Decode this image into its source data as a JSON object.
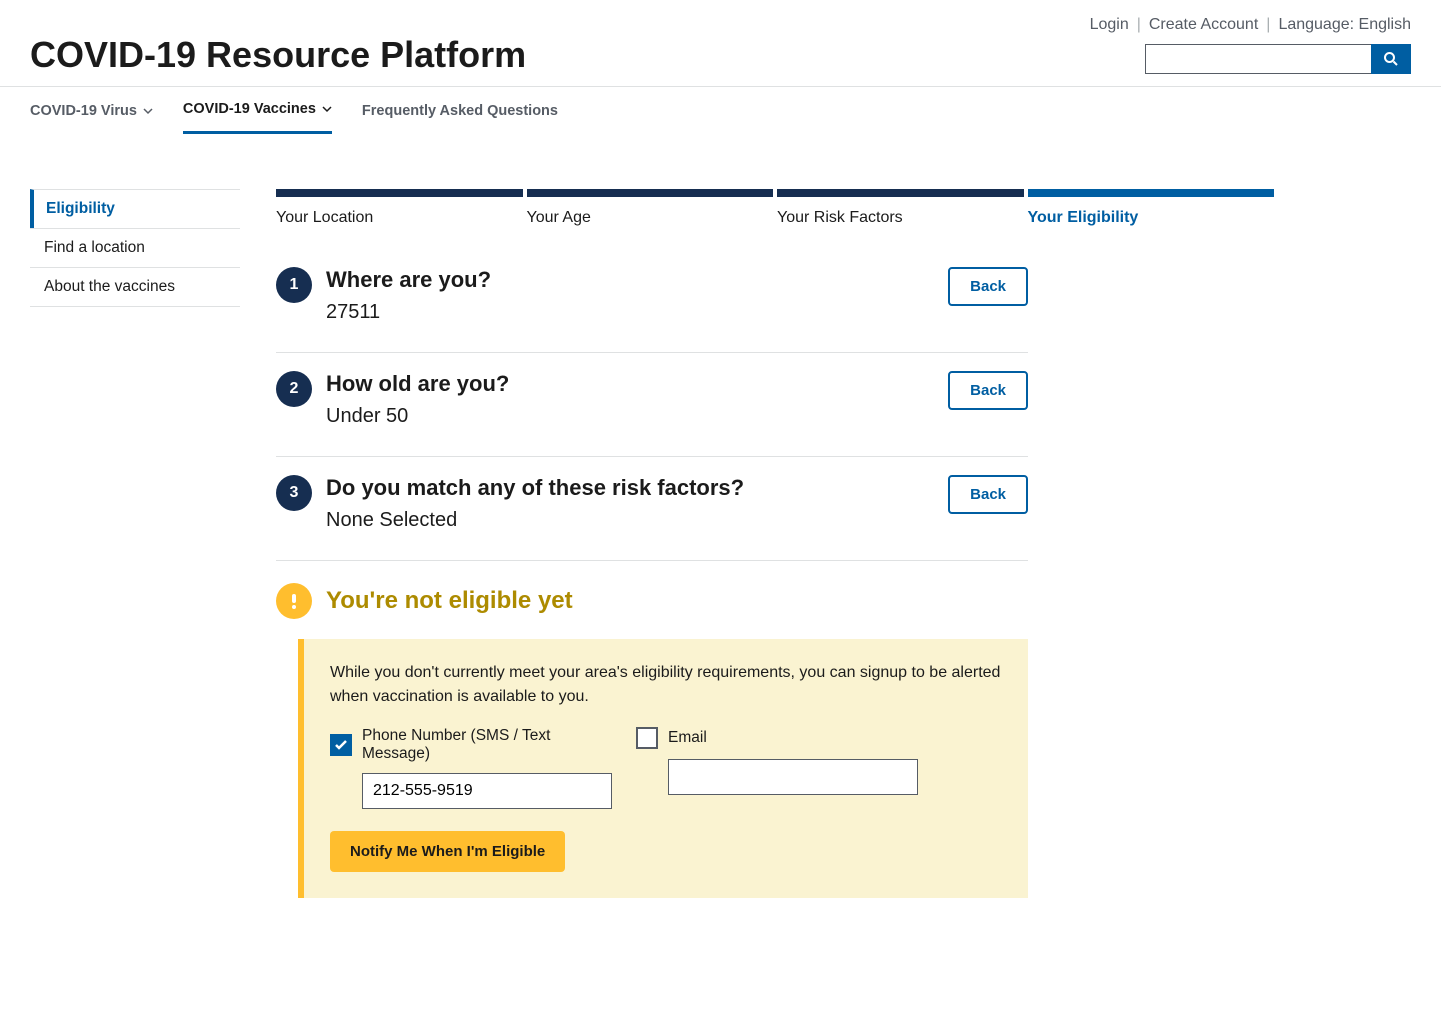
{
  "header": {
    "title": "COVID-19 Resource Platform",
    "links": {
      "login": "Login",
      "create": "Create Account",
      "language": "Language: English"
    },
    "search_placeholder": ""
  },
  "nav": {
    "items": [
      {
        "label": "COVID-19 Virus",
        "dropdown": true,
        "active": false
      },
      {
        "label": "COVID-19 Vaccines",
        "dropdown": true,
        "active": true
      },
      {
        "label": "Frequently Asked Questions",
        "dropdown": false,
        "active": false
      }
    ]
  },
  "sidebar": {
    "items": [
      {
        "label": "Eligibility",
        "active": true
      },
      {
        "label": "Find a location",
        "active": false
      },
      {
        "label": "About the vaccines",
        "active": false
      }
    ]
  },
  "progress": {
    "steps": [
      {
        "label": "Your Location",
        "state": "done"
      },
      {
        "label": "Your Age",
        "state": "done"
      },
      {
        "label": "Your Risk Factors",
        "state": "done"
      },
      {
        "label": "Your Eligibility",
        "state": "active"
      }
    ]
  },
  "steps": [
    {
      "num": "1",
      "question": "Where are you?",
      "answer": "27511",
      "back": "Back"
    },
    {
      "num": "2",
      "question": "How old are you?",
      "answer": "Under 50",
      "back": "Back"
    },
    {
      "num": "3",
      "question": "Do you match any of these risk factors?",
      "answer": "None Selected",
      "back": "Back"
    }
  ],
  "result": {
    "heading": "You're not eligible yet",
    "copy": "While you don't currently meet your area's eligibility requirements, you can signup to be alerted when vaccination is available to you.",
    "phone_label": "Phone Number (SMS / Text Message)",
    "phone_checked": true,
    "phone_value": "212-555-9519",
    "email_label": "Email",
    "email_checked": false,
    "email_value": "",
    "button": "Notify Me When I'm Eligible"
  },
  "colors": {
    "accent": "#005ea2",
    "navy": "#162e51",
    "warn": "#ffbe2e",
    "warn_text": "#ad8b00",
    "warn_bg": "#faf3d1"
  }
}
